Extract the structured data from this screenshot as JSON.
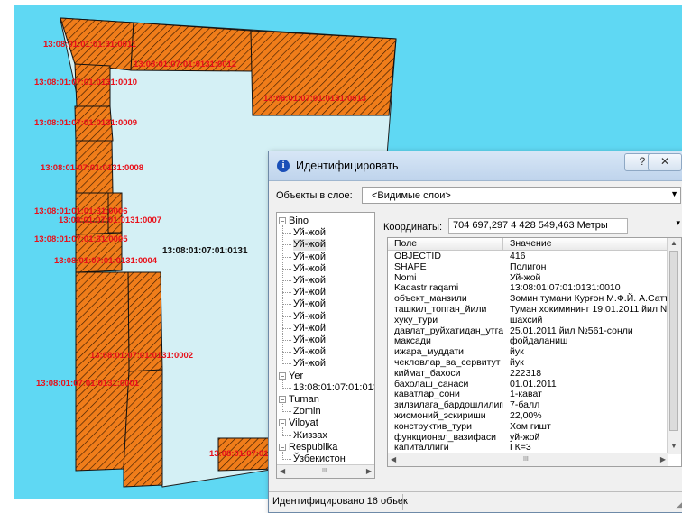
{
  "map": {
    "background_color": "#ffffff",
    "sky_color": "#5fd8f3",
    "inner_color": "#d4f0f5",
    "parcel_fill": "#f07d1a",
    "parcel_labels": [
      "13:08:01:01:01:31:0011",
      "13:08:01:07:01:0131:0012",
      "13:08:01:07:01:0131:0010",
      "13:08:01:07:01:0131:0013",
      "13:08:01:07:01:0131:0009",
      "13:08:01:07:01:0131:0008",
      "13:08:01:01:01:31:0006",
      "13:08:01:07:01:0131:0007",
      "13:08:01:07:01:31:0005",
      "13:08:01:07:01:0131:0004",
      "13:08:01:07:01:0131:0002",
      "13:08:01:07:01:0131:0001",
      "13:08:01:07:01"
    ],
    "block_label": "13:08:01:07:01:0131"
  },
  "dialog": {
    "title": "Идентифицировать",
    "help_button": "?",
    "close_button": "✕",
    "layer_label": "Объекты в слое:",
    "layer_value": "<Видимые слои>",
    "coord_label": "Координаты:",
    "coord_value": "704 697,297  4 428 549,463 Метры",
    "tree": [
      {
        "label": "Bino",
        "level": 0,
        "toggle": "−"
      },
      {
        "label": "Уй-жой",
        "level": 1
      },
      {
        "label": "Уй-жой",
        "level": 1
      },
      {
        "label": "Уй-жой",
        "level": 1
      },
      {
        "label": "Уй-жой",
        "level": 1
      },
      {
        "label": "Уй-жой",
        "level": 1
      },
      {
        "label": "Уй-жой",
        "level": 1
      },
      {
        "label": "Уй-жой",
        "level": 1
      },
      {
        "label": "Уй-жой",
        "level": 1
      },
      {
        "label": "Уй-жой",
        "level": 1
      },
      {
        "label": "Уй-жой",
        "level": 1
      },
      {
        "label": "Уй-жой",
        "level": 1
      },
      {
        "label": "Уй-жой",
        "level": 1
      },
      {
        "label": "Yer",
        "level": 0,
        "toggle": "−"
      },
      {
        "label": "13:08:01:07:01:013",
        "level": 1
      },
      {
        "label": "Tuman",
        "level": 0,
        "toggle": "−"
      },
      {
        "label": "Zomin",
        "level": 1
      },
      {
        "label": "Viloyat",
        "level": 0,
        "toggle": "−"
      },
      {
        "label": "Жиззах",
        "level": 1
      },
      {
        "label": "Respublika",
        "level": 0,
        "toggle": "−"
      },
      {
        "label": "Ўзбекистон",
        "level": 1
      }
    ],
    "grid": {
      "header_field": "Поле",
      "header_value": "Значение",
      "rows": [
        [
          "OBJECTID",
          "416"
        ],
        [
          "SHAPE",
          "Полигон"
        ],
        [
          "Nomi",
          "Уй-жой"
        ],
        [
          "Kadastr raqami",
          "13:08:01:07:01:0131:0010"
        ],
        [
          "объект_манзили",
          "Зомин тумани Курғон М.Ф.Й. А.Сатторов"
        ],
        [
          "ташкил_топган_йили",
          "Туман хокимининг 19.01.2011 йил №34"
        ],
        [
          "хуку_тури",
          "шахсий"
        ],
        [
          "давлат_руйхатидан_утга...",
          "25.01.2011 йил №561-сонли"
        ],
        [
          "максади",
          "фойдаланиш"
        ],
        [
          "ижара_муддати",
          "йук"
        ],
        [
          "чекловлар_ва_сервитут",
          "йук"
        ],
        [
          "киймат_бахоси",
          "222318"
        ],
        [
          "бахолаш_санаси",
          "01.01.2011"
        ],
        [
          "каватлар_сони",
          "1-кават"
        ],
        [
          "зилзилага_бардошлилиги",
          "7-балл"
        ],
        [
          "жисмоний_эскириши",
          "22,00%"
        ],
        [
          "конструктив_тури",
          "Хом гишт"
        ],
        [
          "функционал_вазифаси",
          "уй-жой"
        ],
        [
          "капиталлиги",
          "ГК=3"
        ]
      ]
    },
    "tree_scroll_grip": "III",
    "grid_scroll_grip": "III",
    "status": "Идентифицировано 16 объек"
  }
}
